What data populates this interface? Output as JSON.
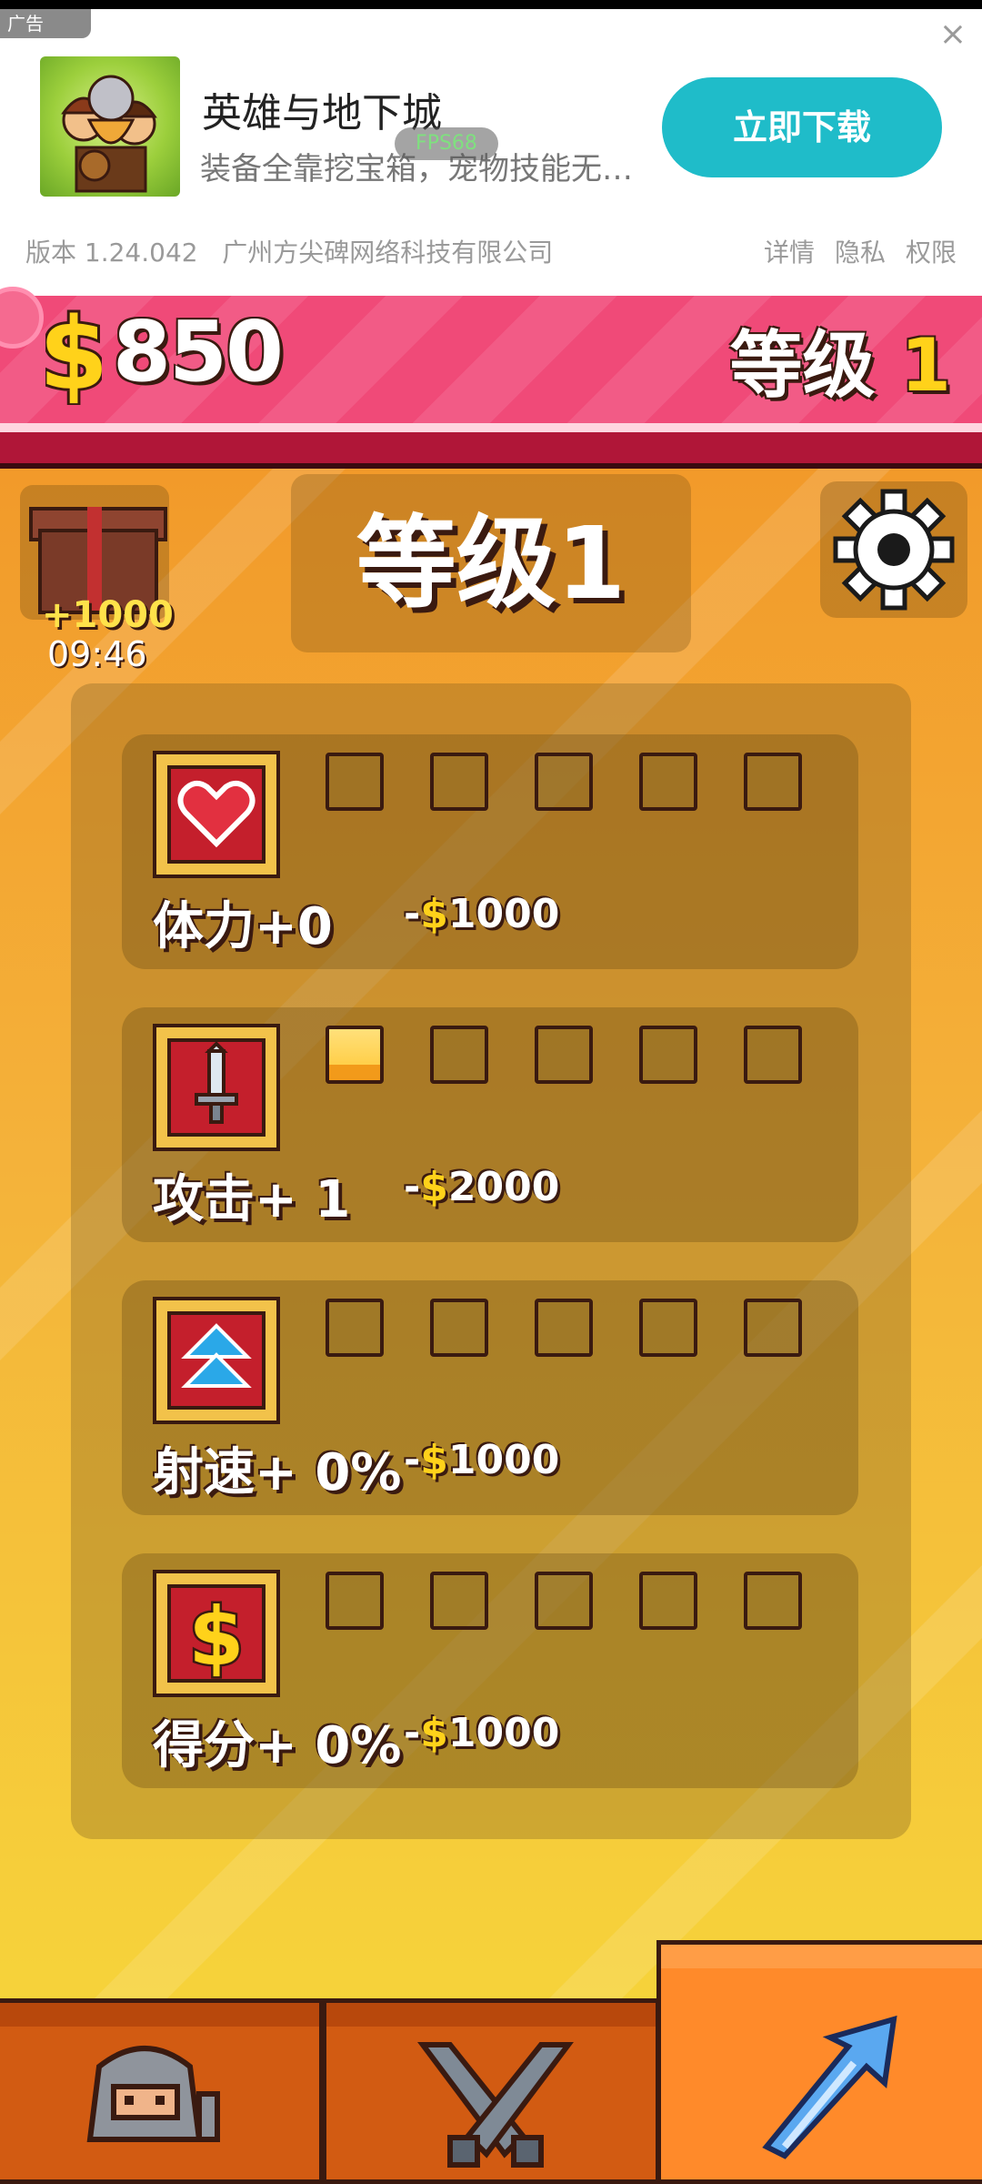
{
  "ad": {
    "tag": "广告",
    "close_glyph": "×",
    "app_name": "英雄与地下城",
    "description": "装备全靠挖宝箱，宠物技能无限...",
    "fps": "FPS68",
    "download_label": "立即下载",
    "version": "版本 1.24.042",
    "company": "广州方尖碑网络科技有限公司",
    "links": [
      "详情",
      "隐私",
      "权限"
    ]
  },
  "hud": {
    "money": "850",
    "level_label": "等级",
    "level_value": "1"
  },
  "gift": {
    "bonus": "+1000",
    "timer": "09:46"
  },
  "title": "等级1",
  "upgrades": [
    {
      "label": "体力+0",
      "cost_prefix": "-",
      "currency": "$",
      "cost": "1000",
      "filled": 0,
      "icon": "heart-icon"
    },
    {
      "label": "攻击+ 1",
      "cost_prefix": "-",
      "currency": "$",
      "cost": "2000",
      "filled": 1,
      "icon": "sword-icon"
    },
    {
      "label": "射速+ 0%",
      "cost_prefix": "-",
      "currency": "$",
      "cost": "1000",
      "filled": 0,
      "icon": "double-arrow-up-icon"
    },
    {
      "label": "得分+ 0%",
      "cost_prefix": "-",
      "currency": "$",
      "cost": "1000",
      "filled": 0,
      "icon": "dollar-icon"
    }
  ],
  "nav": [
    {
      "name": "character",
      "icon": "knight-icon",
      "active": false
    },
    {
      "name": "battle",
      "icon": "crossed-swords-icon",
      "active": false
    },
    {
      "name": "upgrade",
      "icon": "upgrade-arrow-icon",
      "active": true
    }
  ],
  "colors": {
    "hud_pink": "#f04a78",
    "accent_gold": "#ffd21a",
    "download_button": "#1fbcc9",
    "tile_red": "#c41f2c"
  }
}
